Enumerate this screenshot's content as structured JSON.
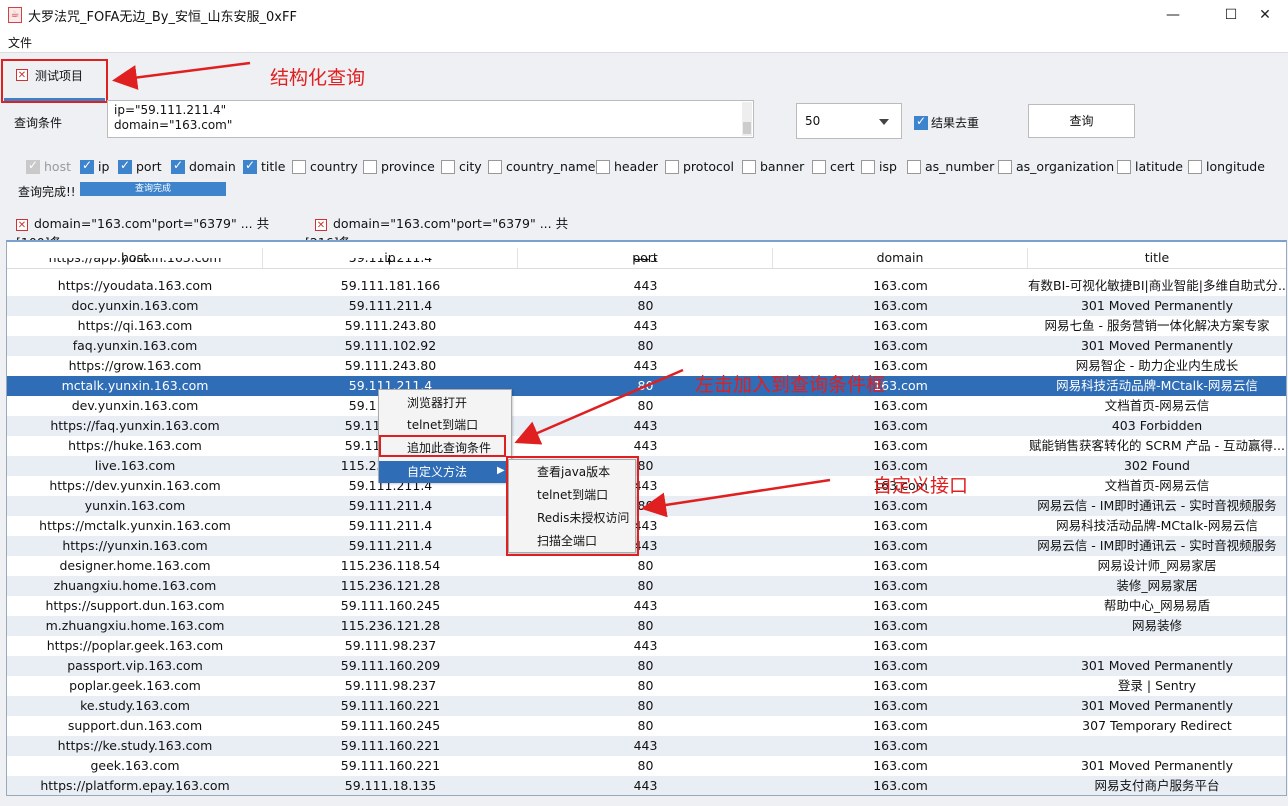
{
  "window": {
    "title": "大罗法咒_FOFA无边_By_安恒_山东安服_0xFF",
    "minimize": "—",
    "maximize": "☐",
    "close": "✕"
  },
  "menu": {
    "file": "文件"
  },
  "project_tab": {
    "label": "测试项目"
  },
  "annotations": {
    "structured": "结构化查询",
    "left_click": "左击加入到查询条件框",
    "custom": "自定义接口"
  },
  "query": {
    "label": "查询条件",
    "line1": "ip=\"59.111.211.4\"",
    "line2": "domain=\"163.com\"",
    "count": "50",
    "dedup": "结果去重",
    "button": "查询"
  },
  "fields": [
    {
      "name": "host",
      "checked": true,
      "disabled": true
    },
    {
      "name": "ip",
      "checked": true
    },
    {
      "name": "port",
      "checked": true
    },
    {
      "name": "domain",
      "checked": true
    },
    {
      "name": "title",
      "checked": true
    },
    {
      "name": "country",
      "checked": false
    },
    {
      "name": "province",
      "checked": false
    },
    {
      "name": "city",
      "checked": false
    },
    {
      "name": "country_name",
      "checked": false
    },
    {
      "name": "header",
      "checked": false
    },
    {
      "name": "protocol",
      "checked": false
    },
    {
      "name": "banner",
      "checked": false
    },
    {
      "name": "cert",
      "checked": false
    },
    {
      "name": "isp",
      "checked": false
    },
    {
      "name": "as_number",
      "checked": false
    },
    {
      "name": "as_organization",
      "checked": false
    },
    {
      "name": "latitude",
      "checked": false
    },
    {
      "name": "longitude",
      "checked": false
    }
  ],
  "status": {
    "text": "查询完成!!",
    "progress_label": "查询完成",
    "progress": 1.0
  },
  "result_tabs": [
    {
      "label": "domain=\"163.com\"port=\"6379\" ... 共[100]条"
    },
    {
      "label": "domain=\"163.com\"port=\"6379\" ... 共[216]条",
      "active": true
    }
  ],
  "table": {
    "columns": [
      "host",
      "ip",
      "port",
      "domain",
      "title"
    ],
    "partial_top": [
      "https://app.yunxin.163.com",
      "59.111.211.4",
      "443",
      "",
      ""
    ],
    "rows": [
      [
        "https://youdata.163.com",
        "59.111.181.166",
        "443",
        "163.com",
        "有数BI-可视化敏捷BI|商业智能|多维自助式分..."
      ],
      [
        "doc.yunxin.163.com",
        "59.111.211.4",
        "80",
        "163.com",
        "301 Moved Permanently"
      ],
      [
        "https://qi.163.com",
        "59.111.243.80",
        "443",
        "163.com",
        "网易七鱼 - 服务营销一体化解决方案专家"
      ],
      [
        "faq.yunxin.163.com",
        "59.111.102.92",
        "80",
        "163.com",
        "301 Moved Permanently"
      ],
      [
        "https://grow.163.com",
        "59.111.243.80",
        "443",
        "163.com",
        "网易智企 - 助力企业内生成长"
      ],
      [
        "mctalk.yunxin.163.com",
        "59.111.211.4",
        "80",
        "163.com",
        "网易科技活动品牌-MCtalk-网易云信"
      ],
      [
        "dev.yunxin.163.com",
        "59.111.211.4",
        "80",
        "163.com",
        "文档首页-网易云信"
      ],
      [
        "https://faq.yunxin.163.com",
        "59.111.102.92",
        "443",
        "163.com",
        "403 Forbidden"
      ],
      [
        "https://huke.163.com",
        "59.111.243.80",
        "443",
        "163.com",
        "赋能销售获客转化的 SCRM 产品 - 互动赢得..."
      ],
      [
        "live.163.com",
        "115.236.121.28",
        "80",
        "163.com",
        "302 Found"
      ],
      [
        "https://dev.yunxin.163.com",
        "59.111.211.4",
        "443",
        "163.com",
        "文档首页-网易云信"
      ],
      [
        "yunxin.163.com",
        "59.111.211.4",
        "80",
        "163.com",
        "网易云信 - IM即时通讯云 - 实时音视频服务"
      ],
      [
        "https://mctalk.yunxin.163.com",
        "59.111.211.4",
        "443",
        "163.com",
        "网易科技活动品牌-MCtalk-网易云信"
      ],
      [
        "https://yunxin.163.com",
        "59.111.211.4",
        "443",
        "163.com",
        "网易云信 - IM即时通讯云 - 实时音视频服务"
      ],
      [
        "designer.home.163.com",
        "115.236.118.54",
        "80",
        "163.com",
        "网易设计师_网易家居"
      ],
      [
        "zhuangxiu.home.163.com",
        "115.236.121.28",
        "80",
        "163.com",
        "装修_网易家居"
      ],
      [
        "https://support.dun.163.com",
        "59.111.160.245",
        "443",
        "163.com",
        "帮助中心_网易易盾"
      ],
      [
        "m.zhuangxiu.home.163.com",
        "115.236.121.28",
        "80",
        "163.com",
        "网易装修"
      ],
      [
        "https://poplar.geek.163.com",
        "59.111.98.237",
        "443",
        "163.com",
        ""
      ],
      [
        "passport.vip.163.com",
        "59.111.160.209",
        "80",
        "163.com",
        "301 Moved Permanently"
      ],
      [
        "poplar.geek.163.com",
        "59.111.98.237",
        "80",
        "163.com",
        "登录 | Sentry"
      ],
      [
        "ke.study.163.com",
        "59.111.160.221",
        "80",
        "163.com",
        "301 Moved Permanently"
      ],
      [
        "support.dun.163.com",
        "59.111.160.245",
        "80",
        "163.com",
        "307 Temporary Redirect"
      ],
      [
        "https://ke.study.163.com",
        "59.111.160.221",
        "443",
        "163.com",
        ""
      ],
      [
        "geek.163.com",
        "59.111.160.221",
        "80",
        "163.com",
        "301 Moved Permanently"
      ],
      [
        "https://platform.epay.163.com",
        "59.111.18.135",
        "443",
        "163.com",
        "网易支付商户服务平台"
      ]
    ],
    "overlapped_ip_visible": [
      "59.111.211.4",
      "59.1",
      "59.11",
      "59.1",
      "59.11",
      "115.2",
      "59.11"
    ],
    "selected_row": 5
  },
  "context_menu": {
    "items": [
      "浏览器打开",
      "telnet到端口",
      "追加此查询条件",
      "自定义方法"
    ],
    "submenu": [
      "查看java版本",
      "telnet到端口",
      "Redis未授权访问",
      "扫描全端口"
    ]
  }
}
